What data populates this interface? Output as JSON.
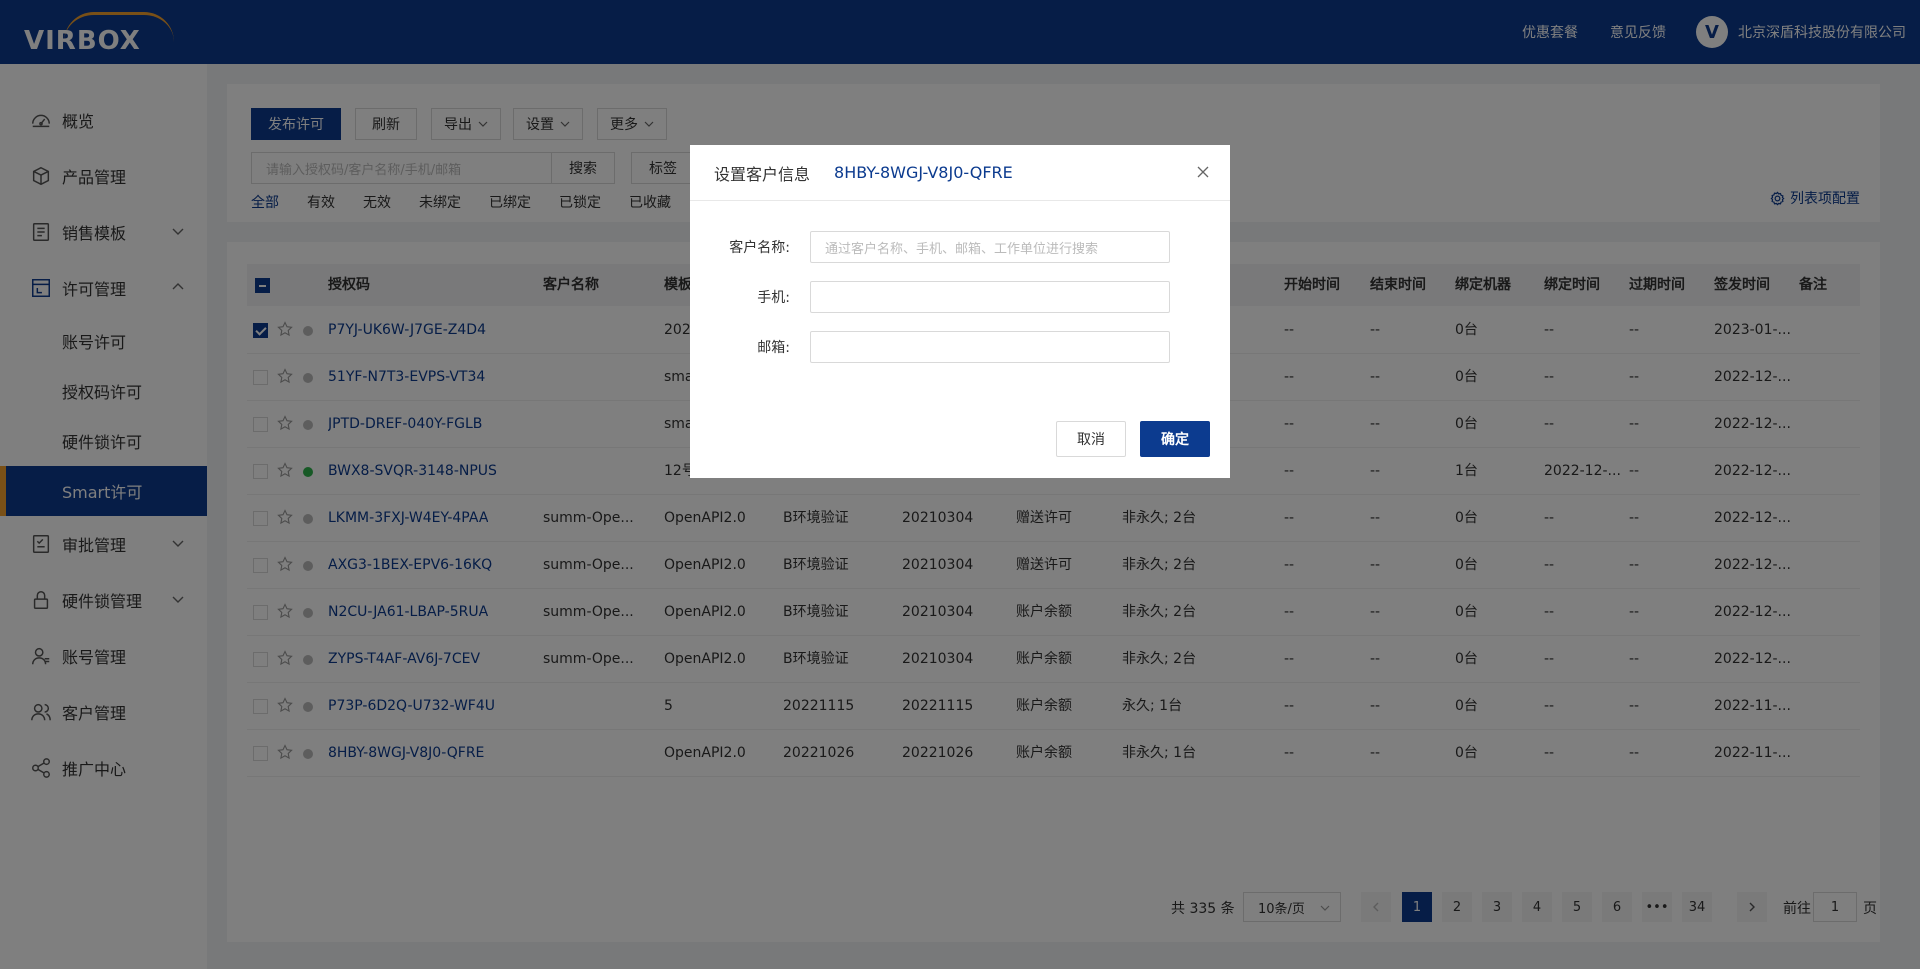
{
  "header": {
    "brand": "VIRBOX",
    "links": [
      "优惠套餐",
      "意见反馈"
    ],
    "company": "北京深盾科技股份有限公司",
    "company_logo": "V"
  },
  "sidebar": {
    "items": [
      {
        "label": "概览",
        "icon": "dashboard-icon"
      },
      {
        "label": "产品管理",
        "icon": "box-icon"
      },
      {
        "label": "销售模板",
        "icon": "template-icon",
        "arrow": "down"
      },
      {
        "label": "许可管理",
        "icon": "license-icon",
        "arrow": "up"
      }
    ],
    "sub_items": [
      "账号许可",
      "授权码许可",
      "硬件锁许可",
      "Smart许可"
    ],
    "items_after": [
      {
        "label": "审批管理",
        "icon": "approval-icon",
        "arrow": "down"
      },
      {
        "label": "硬件锁管理",
        "icon": "lock-icon",
        "arrow": "down"
      },
      {
        "label": "账号管理",
        "icon": "user-icon"
      },
      {
        "label": "客户管理",
        "icon": "customers-icon"
      },
      {
        "label": "推广中心",
        "icon": "share-icon"
      }
    ]
  },
  "toolbar": {
    "publish": "发布许可",
    "refresh": "刷新",
    "export": "导出",
    "settings": "设置",
    "more": "更多",
    "search_placeholder": "请输入授权码/客户名称/手机/邮箱",
    "search": "搜索",
    "tag": "标签",
    "filters": [
      "全部",
      "有效",
      "无效",
      "未绑定",
      "已绑定",
      "已锁定",
      "已收藏"
    ],
    "column_config": "列表项配置"
  },
  "table": {
    "headers": {
      "code": "授权码",
      "customer": "客户名称",
      "template": "模板",
      "start": "开始时间",
      "end": "结束时间",
      "bound": "绑定机器",
      "bind_time": "绑定时间",
      "expire": "过期时间",
      "issue": "签发时间",
      "note": "备注"
    },
    "rows": [
      {
        "checked": true,
        "status": "grey",
        "code": "P7YJ-UK6W-J7GE-Z4D4",
        "customer": "",
        "template": "202",
        "c4": "",
        "c5": "",
        "c6": "",
        "c7": "",
        "start": "--",
        "end": "--",
        "bound": "0台",
        "bind_time": "--",
        "expire": "--",
        "issue": "2023-01-..."
      },
      {
        "checked": false,
        "status": "grey",
        "code": "51YF-N7T3-EVPS-VT34",
        "customer": "",
        "template": "sma",
        "c4": "",
        "c5": "",
        "c6": "",
        "c7": "",
        "start": "--",
        "end": "--",
        "bound": "0台",
        "bind_time": "--",
        "expire": "--",
        "issue": "2022-12-..."
      },
      {
        "checked": false,
        "status": "grey",
        "code": "JPTD-DREF-040Y-FGLB",
        "customer": "",
        "template": "sma",
        "c4": "",
        "c5": "",
        "c6": "",
        "c7": "",
        "start": "--",
        "end": "--",
        "bound": "0台",
        "bind_time": "--",
        "expire": "--",
        "issue": "2022-12-..."
      },
      {
        "checked": false,
        "status": "green",
        "code": "BWX8-SVQR-3148-NPUS",
        "customer": "",
        "template": "12号",
        "c4": "",
        "c5": "",
        "c6": "",
        "c7": "",
        "start": "--",
        "end": "--",
        "bound": "1台",
        "bind_time": "2022-12-...",
        "expire": "--",
        "issue": "2022-12-..."
      },
      {
        "checked": false,
        "status": "grey",
        "code": "LKMM-3FXJ-W4EY-4PAA",
        "customer": "summ-Ope...",
        "template": "OpenAPI2.0",
        "c4": "B环境验证",
        "c5": "20210304",
        "c6": "赠送许可",
        "c7": "非永久; 2台",
        "start": "--",
        "end": "--",
        "bound": "0台",
        "bind_time": "--",
        "expire": "--",
        "issue": "2022-12-..."
      },
      {
        "checked": false,
        "status": "grey",
        "code": "AXG3-1BEX-EPV6-16KQ",
        "customer": "summ-Ope...",
        "template": "OpenAPI2.0",
        "c4": "B环境验证",
        "c5": "20210304",
        "c6": "赠送许可",
        "c7": "非永久; 2台",
        "start": "--",
        "end": "--",
        "bound": "0台",
        "bind_time": "--",
        "expire": "--",
        "issue": "2022-12-..."
      },
      {
        "checked": false,
        "status": "grey",
        "code": "N2CU-JA61-LBAP-5RUA",
        "customer": "summ-Ope...",
        "template": "OpenAPI2.0",
        "c4": "B环境验证",
        "c5": "20210304",
        "c6": "账户余额",
        "c7": "非永久; 2台",
        "start": "--",
        "end": "--",
        "bound": "0台",
        "bind_time": "--",
        "expire": "--",
        "issue": "2022-12-..."
      },
      {
        "checked": false,
        "status": "grey",
        "code": "ZYPS-T4AF-AV6J-7CEV",
        "customer": "summ-Ope...",
        "template": "OpenAPI2.0",
        "c4": "B环境验证",
        "c5": "20210304",
        "c6": "账户余额",
        "c7": "非永久; 2台",
        "start": "--",
        "end": "--",
        "bound": "0台",
        "bind_time": "--",
        "expire": "--",
        "issue": "2022-12-..."
      },
      {
        "checked": false,
        "status": "grey",
        "code": "P73P-6D2Q-U732-WF4U",
        "customer": "",
        "template": "5",
        "c4": "20221115",
        "c5": "20221115",
        "c6": "账户余额",
        "c7": "永久; 1台",
        "start": "--",
        "end": "--",
        "bound": "0台",
        "bind_time": "--",
        "expire": "--",
        "issue": "2022-11-..."
      },
      {
        "checked": false,
        "status": "grey",
        "code": "8HBY-8WGJ-V8J0-QFRE",
        "customer": "",
        "template": "OpenAPI2.0",
        "c4": "20221026",
        "c5": "20221026",
        "c6": "账户余额",
        "c7": "非永久; 1台",
        "start": "--",
        "end": "--",
        "bound": "0台",
        "bind_time": "--",
        "expire": "--",
        "issue": "2022-11-..."
      }
    ]
  },
  "pagination": {
    "total": "共 335 条",
    "page_size": "10条/页",
    "pages": [
      "1",
      "2",
      "3",
      "4",
      "5",
      "6",
      "•••",
      "34"
    ],
    "current": "1",
    "goto_label": "前往",
    "goto_value": "1",
    "page_suffix": "页"
  },
  "modal": {
    "title": "设置客户信息",
    "code": "8HBY-8WGJ-V8J0-QFRE",
    "fields": [
      {
        "label": "客户名称:",
        "placeholder": "通过客户名称、手机、邮箱、工作单位进行搜索"
      },
      {
        "label": "手机:",
        "placeholder": ""
      },
      {
        "label": "邮箱:",
        "placeholder": ""
      }
    ],
    "cancel": "取消",
    "ok": "确定"
  },
  "colors": {
    "primary": "#0c3b8f",
    "accent": "#f2a02e",
    "status_green": "#2fb34d"
  }
}
